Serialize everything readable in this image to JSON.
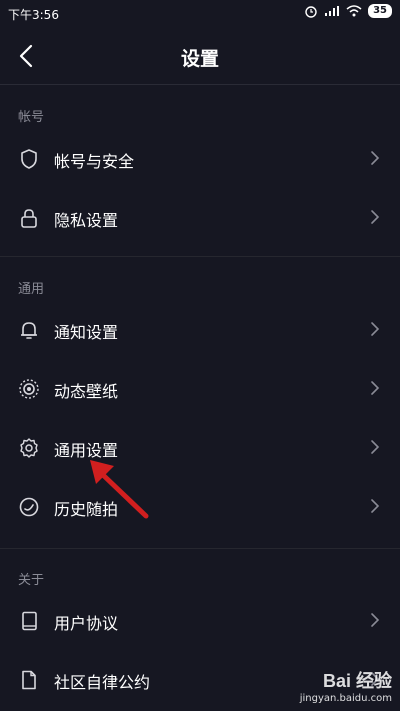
{
  "status_bar": {
    "time": "下午3:56",
    "battery": "35"
  },
  "header": {
    "title": "设置"
  },
  "sections": [
    {
      "label": "帐号"
    },
    {
      "label": "通用"
    },
    {
      "label": "关于"
    }
  ],
  "items": {
    "account_security": {
      "label": "帐号与安全",
      "icon": "shield-icon"
    },
    "privacy": {
      "label": "隐私设置",
      "icon": "lock-icon"
    },
    "notifications": {
      "label": "通知设置",
      "icon": "bell-icon"
    },
    "live_wallpaper": {
      "label": "动态壁纸",
      "icon": "wallpaper-icon"
    },
    "general": {
      "label": "通用设置",
      "icon": "gear-icon"
    },
    "history": {
      "label": "历史随拍",
      "icon": "history-icon"
    },
    "user_agreement": {
      "label": "用户协议",
      "icon": "book-icon"
    },
    "community": {
      "label": "社区自律公约",
      "icon": "document-icon"
    }
  },
  "colors": {
    "background": "#161722",
    "text": "#ffffff",
    "muted": "#8a8b96",
    "arrow": "#d11f1f"
  },
  "watermark": {
    "brand": "Bai 经验",
    "url": "jingyan.baidu.com"
  }
}
